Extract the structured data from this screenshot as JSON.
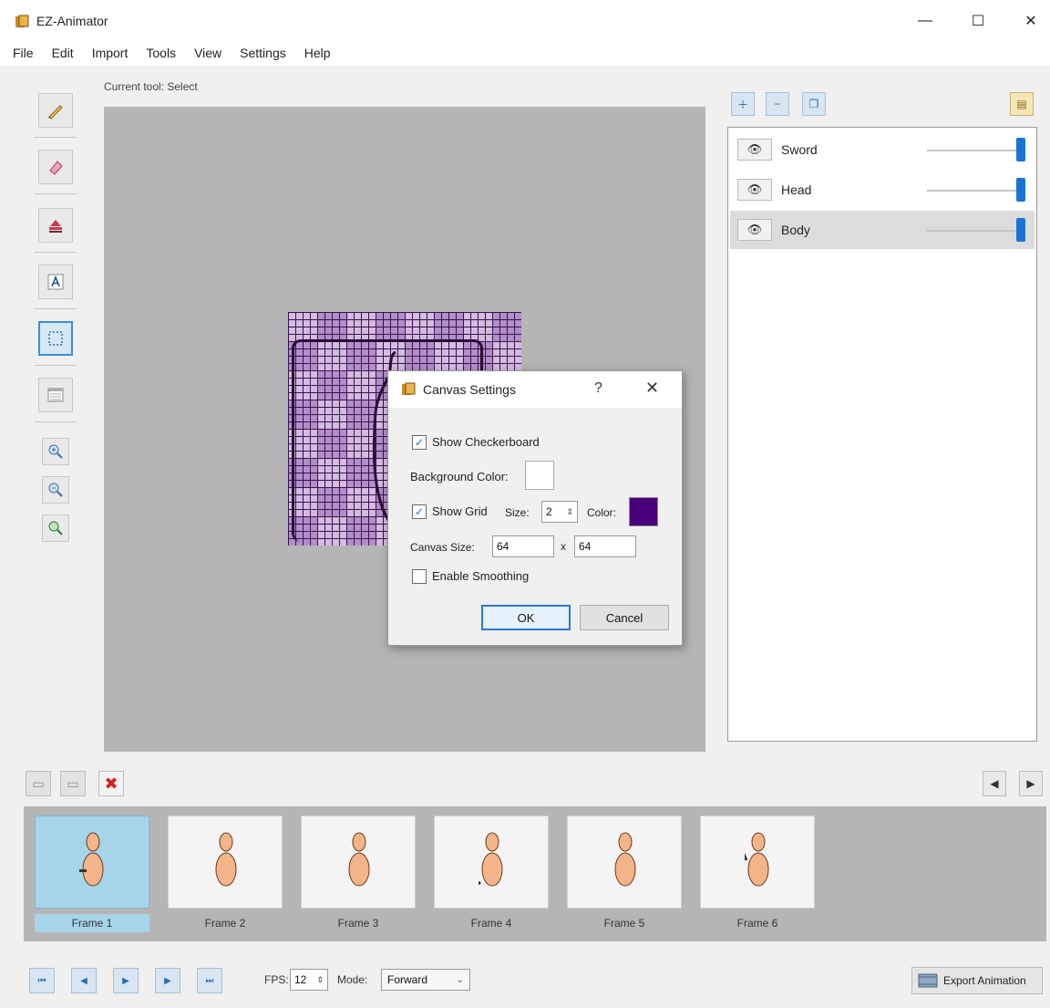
{
  "window": {
    "title": "EZ-Animator",
    "min_glyph": "—",
    "max_glyph": "☐",
    "close_glyph": "✕"
  },
  "menu": [
    "File",
    "Edit",
    "Import",
    "Tools",
    "View",
    "Settings",
    "Help"
  ],
  "status": {
    "current_tool": "Current tool: Select"
  },
  "dialog": {
    "title": "Canvas Settings",
    "help": "?",
    "close": "✕",
    "show_checkerboard": {
      "label": "Show Checkerboard",
      "checked": true
    },
    "background_color": {
      "label": "Background Color:",
      "value": "#ffffff"
    },
    "show_grid": {
      "label": "Show Grid",
      "checked": true
    },
    "grid_size": {
      "label": "Size:",
      "value": "2"
    },
    "grid_color": {
      "label": "Color:",
      "value": "#4a007a"
    },
    "canvas_size": {
      "label": "Canvas Size:",
      "width": "64",
      "separator": "x",
      "height": "64"
    },
    "enable_smoothing": {
      "label": "Enable Smoothing",
      "checked": false
    },
    "ok_label": "OK",
    "cancel_label": "Cancel"
  },
  "layers": [
    {
      "name": "Sword",
      "opacity": 1.0,
      "selected": false
    },
    {
      "name": "Head",
      "opacity": 1.0,
      "selected": false
    },
    {
      "name": "Body",
      "opacity": 1.0,
      "selected": true
    }
  ],
  "frames": [
    {
      "label": "Frame 1",
      "selected": true
    },
    {
      "label": "Frame 2",
      "selected": false
    },
    {
      "label": "Frame 3",
      "selected": false
    },
    {
      "label": "Frame 4",
      "selected": false
    },
    {
      "label": "Frame 5",
      "selected": false
    },
    {
      "label": "Frame 6",
      "selected": false
    }
  ],
  "playback": {
    "fps_label": "FPS:",
    "fps_value": "12",
    "mode_label": "Mode:",
    "mode_value": "Forward",
    "export_label": "Export Animation"
  },
  "colors": {
    "accent": "#1a73d1",
    "grid": "#4a007a",
    "selected_frame": "#a6d5ea",
    "viewport": "#b5b5b5"
  }
}
